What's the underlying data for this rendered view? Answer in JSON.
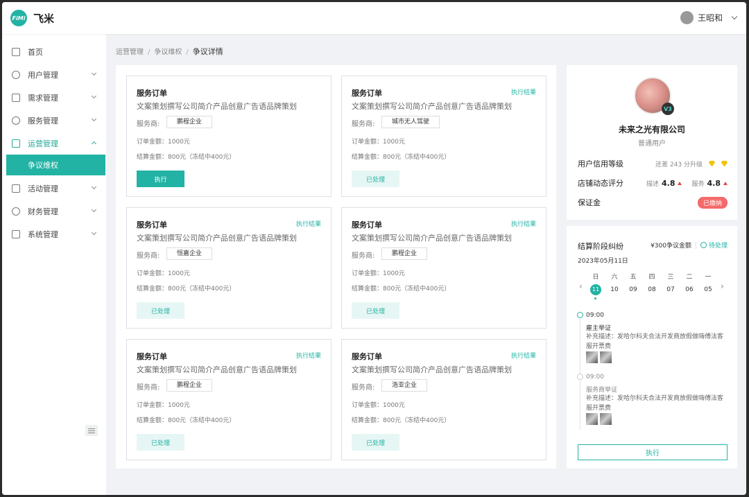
{
  "app": {
    "logo_text": "FiMi",
    "name": "飞米"
  },
  "user": {
    "name": "王昭和"
  },
  "sidebar": {
    "items": [
      {
        "label": "首页"
      },
      {
        "label": "用户管理"
      },
      {
        "label": "需求管理"
      },
      {
        "label": "服务管理"
      },
      {
        "label": "运营管理"
      },
      {
        "label": "活动管理"
      },
      {
        "label": "财务管理"
      },
      {
        "label": "系统管理"
      }
    ],
    "active_sub": "争议维权"
  },
  "breadcrumb": {
    "items": [
      "运营管理",
      "争议维权"
    ],
    "sep": "/",
    "current": "争议详情"
  },
  "cards": [
    {
      "title": "服务订单",
      "result": "",
      "desc": "文案策划撰写公司简介产品创意广告语品牌策划",
      "provider_label": "服务商:",
      "provider": "鹏程企业",
      "amount": "订单金额：1000元",
      "settle": "结算金额：800元（冻结中400元）",
      "button": "执行"
    },
    {
      "title": "服务订单",
      "result": "执行结果",
      "desc": "文案策划撰写公司简介产品创意广告语品牌策划",
      "provider_label": "服务商:",
      "provider": "城市无人驾驶",
      "amount": "订单金额：1000元",
      "settle": "结算金额：800元（冻结中400元）",
      "button": "已处理"
    },
    {
      "title": "服务订单",
      "result": "执行结果",
      "desc": "文案策划撰写公司简介产品创意广告语品牌策划",
      "provider_label": "服务商:",
      "provider": "恒嘉企业",
      "amount": "订单金额：1000元",
      "settle": "结算金额：800元（冻结中400元）",
      "button": "已处理"
    },
    {
      "title": "服务订单",
      "result": "执行结果",
      "desc": "文案策划撰写公司简介产品创意广告语品牌策划",
      "provider_label": "服务商:",
      "provider": "鹏程企业",
      "amount": "订单金额：1000元",
      "settle": "结算金额：800元（冻结中400元）",
      "button": "已处理"
    },
    {
      "title": "服务订单",
      "result": "执行结果",
      "desc": "文案策划撰写公司简介产品创意广告语品牌策划",
      "provider_label": "服务商:",
      "provider": "鹏程企业",
      "amount": "订单金额：1000元",
      "settle": "结算金额：800元（冻结中400元）",
      "button": "已处理"
    },
    {
      "title": "服务订单",
      "result": "执行结果",
      "desc": "文案策划撰写公司简介产品创意广告语品牌策划",
      "provider_label": "服务商:",
      "provider": "浩亚企业",
      "amount": "订单金额：1000元",
      "settle": "结算金额：800元（冻结中400元）",
      "button": "已处理"
    }
  ],
  "profile": {
    "level_badge": "V3",
    "company": "未来之光有限公司",
    "user_type": "普通用户",
    "credit_label": "用户信用等级",
    "credit_hint": "还差 243 分升级",
    "shop_label": "店铺动态评分",
    "desc_label": "描述",
    "desc_score": "4.8",
    "service_label": "服务",
    "service_score": "4.8",
    "deposit_label": "保证金",
    "deposit_status": "已缴纳"
  },
  "dispute": {
    "title": "结算阶段纠纷",
    "amount": "¥300争议金额",
    "status": "待处理",
    "date": "2023年05月11日",
    "weekdays": [
      "日",
      "六",
      "五",
      "四",
      "三",
      "二",
      "一"
    ],
    "days": [
      "11",
      "10",
      "09",
      "08",
      "07",
      "06",
      "05"
    ],
    "timeline": [
      {
        "time": "09:00",
        "title": "雇主举证",
        "desc": "补充描述：发哈尔科夫合法开发商放假做嗨傅法客服开票费"
      },
      {
        "time": "09:00",
        "title": "服务商举证",
        "desc": "补充描述：发哈尔科夫合法开发商放假做嗨傅法客服开票费"
      }
    ],
    "button": "执行"
  }
}
